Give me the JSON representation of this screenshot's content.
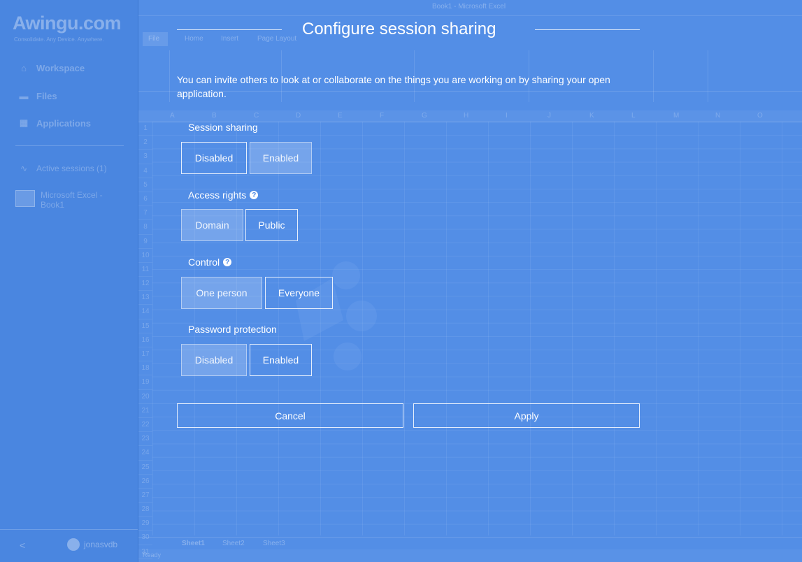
{
  "sidebar": {
    "logo": "Awingu.com",
    "tagline": "Consolidate. Any Device. Anywhere.",
    "items": [
      {
        "label": "Workspace",
        "icon": "home-icon"
      },
      {
        "label": "Files",
        "icon": "folder-icon"
      },
      {
        "label": "Applications",
        "icon": "grid-icon"
      }
    ],
    "active_sessions": "Active sessions (1)",
    "session_app": "Microsoft Excel - Book1",
    "collapse_glyph": "<",
    "user": "jonasvdb"
  },
  "background_app": {
    "window_title": "Book1 - Microsoft Excel",
    "ribbon_tabs": [
      "File",
      "Home",
      "Insert",
      "Page Layout"
    ],
    "column_headers": [
      "A",
      "B",
      "C",
      "D",
      "E",
      "F",
      "G",
      "H",
      "I",
      "J",
      "K",
      "L",
      "M",
      "N",
      "O"
    ],
    "sheet_tabs": [
      "Sheet1",
      "Sheet2",
      "Sheet3"
    ],
    "status": "Ready"
  },
  "dialog": {
    "title": "Configure session sharing",
    "description": "You can invite others to look at or collaborate on the things you are working on by sharing your open application.",
    "session_sharing": {
      "label": "Session sharing",
      "options": [
        "Disabled",
        "Enabled"
      ],
      "selected": "Enabled"
    },
    "access_rights": {
      "label": "Access rights",
      "options": [
        "Domain",
        "Public"
      ],
      "selected": "Domain"
    },
    "control": {
      "label": "Control",
      "options": [
        "One person",
        "Everyone"
      ],
      "selected": "One person"
    },
    "password_protection": {
      "label": "Password protection",
      "options": [
        "Disabled",
        "Enabled"
      ],
      "selected": "Disabled"
    },
    "cancel_label": "Cancel",
    "apply_label": "Apply"
  },
  "colors": {
    "background": "#4f8be6",
    "text": "#ffffff"
  }
}
